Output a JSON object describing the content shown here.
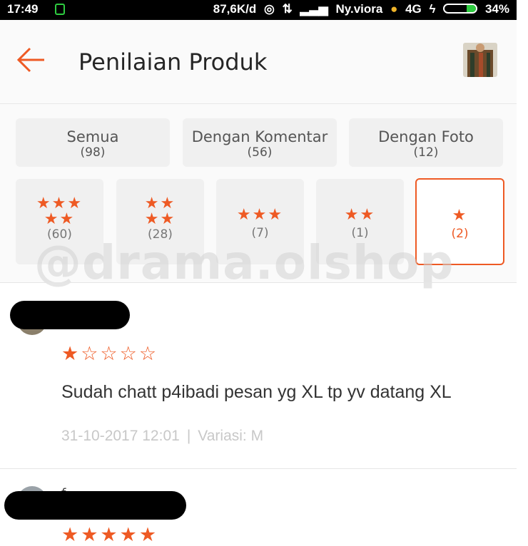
{
  "status_bar": {
    "time": "17:49",
    "speed": "87,6K/d",
    "carrier": "Ny.viora",
    "network": "4G",
    "battery": "34%"
  },
  "header": {
    "title": "Penilaian Produk",
    "back_icon": "arrow-left-icon",
    "accent": "#ee5a24"
  },
  "filters": {
    "tabs": [
      {
        "label": "Semua",
        "count": "(98)"
      },
      {
        "label": "Dengan Komentar",
        "count": "(56)"
      },
      {
        "label": "Dengan Foto",
        "count": "(12)"
      }
    ],
    "star_filters": [
      {
        "stars": 5,
        "count": "(60)"
      },
      {
        "stars": 4,
        "count": "(28)"
      },
      {
        "stars": 3,
        "count": "(7)"
      },
      {
        "stars": 2,
        "count": "(1)"
      },
      {
        "stars": 1,
        "count": "(2)",
        "selected": true
      }
    ]
  },
  "watermark": "@drama.olshop",
  "reviews": [
    {
      "rating": 1,
      "rating_stars": "★☆☆☆☆",
      "comment": "Sudah chatt p4ibadi pesan yg XL tp yv datang XL",
      "date": "31-10-2017 12:01",
      "separator": "|",
      "variation_label": "Variasi:",
      "variation_value": "M"
    },
    {
      "rating": 5,
      "rating_stars": "★★★★★",
      "name_partial": "f"
    }
  ]
}
